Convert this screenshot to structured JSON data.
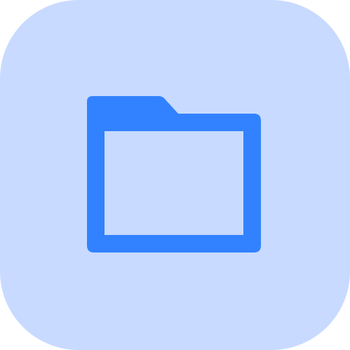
{
  "app_icon": {
    "icon": "folder-icon",
    "colors": {
      "tile_background": "#c8daff",
      "folder": "#3282ff"
    }
  }
}
